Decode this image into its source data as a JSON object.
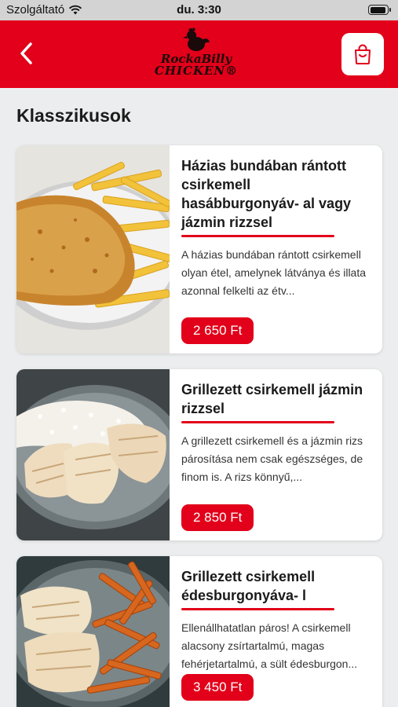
{
  "status_bar": {
    "carrier": "Szolgáltató",
    "time": "du. 3:30"
  },
  "header": {
    "logo_line1": "RockaBilly",
    "logo_line2": "CHICKEN®"
  },
  "section": {
    "title": "Klasszikusok"
  },
  "products": [
    {
      "title": "Házias bundában rántott csirkemell hasábburgonyáv- al vagy jázmin rizzsel",
      "description": "A házias bundában rántott csirkemell olyan étel, amelynek látványa és illata azonnal felkelti az étv...",
      "price": "2 650 Ft"
    },
    {
      "title": "Grillezett csirkemell jázmin rizzsel",
      "description": "A grillezett csirkemell és a jázmin rizs párosítása nem csak egészséges, de finom is. A rizs könnyű,...",
      "price": "2 850 Ft"
    },
    {
      "title": "Grillezett csirkemell édesburgonyáva- l",
      "description": "Ellenállhatatlan páros! A csirkemell alacsony zsírtartalmú, magas fehérjetartalmú, a sült édesburgon...",
      "price": "3 450 Ft"
    }
  ],
  "colors": {
    "brand_red": "#e2001a",
    "background": "#ecedee"
  },
  "icons": {
    "back": "chevron-left-icon",
    "cart": "shopping-bag-icon",
    "wifi": "wifi-icon",
    "battery": "battery-icon"
  }
}
